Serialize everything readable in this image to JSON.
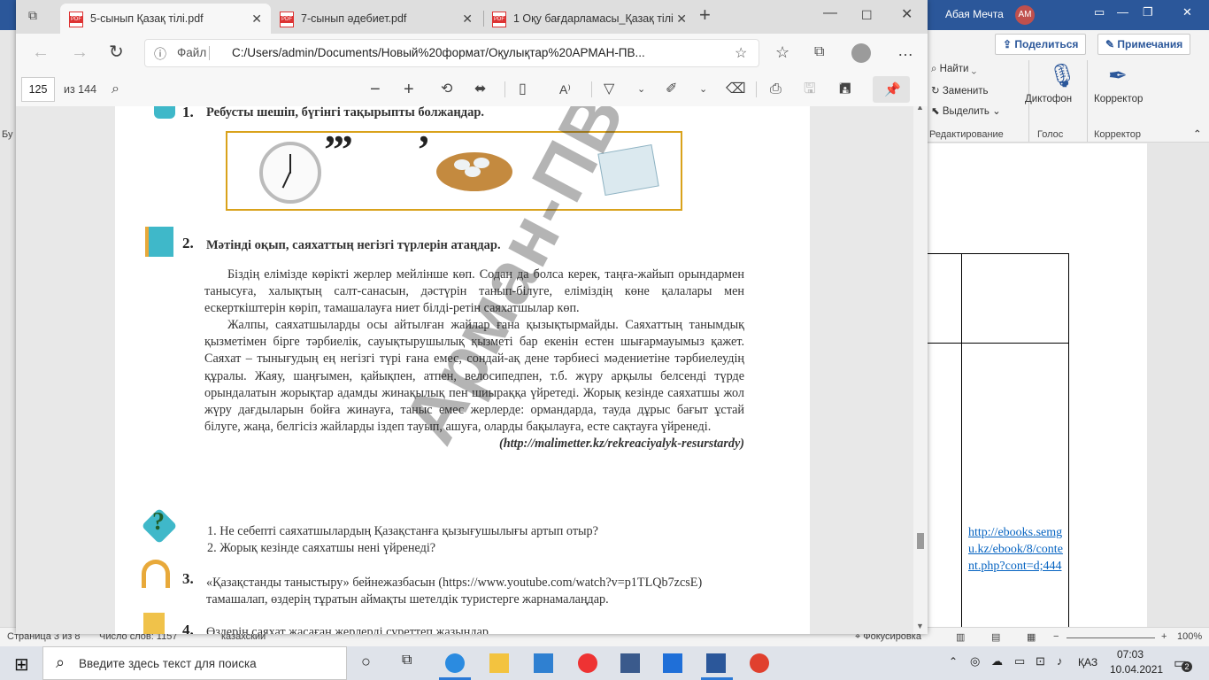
{
  "word": {
    "user_name": "Абая Мечта",
    "user_initials": "AM",
    "share_label": "Поделиться",
    "notes_label": "Примечания",
    "find_label": "Найти",
    "replace_label": "Заменить",
    "select_label": "Выделить",
    "dictate_label": "Диктофон",
    "corrector_label": "Корректор",
    "group_editing": "Редактирование",
    "group_voice": "Голос",
    "group_corrector": "Корректор",
    "left_cut_text": "Бу",
    "doc_link": "http://ebooks.semgu.kz/ebook/8/content.php?cont=d;444",
    "status": {
      "page": "Страница 3 из 8",
      "words": "Число слов: 1157",
      "language": "казахский",
      "focus": "Фокусировка",
      "zoom": "100%"
    }
  },
  "edge": {
    "tabs": [
      {
        "label": "5-сынып Қазақ тілі.pdf",
        "active": true
      },
      {
        "label": "7-сынып әдебиет.pdf",
        "active": false
      },
      {
        "label": "1 Оқу бағдарламасы_Қазақ тілі.",
        "active": false
      }
    ],
    "address": {
      "file_label": "Файл",
      "url": "C:/Users/admin/Documents/Новый%20формат/Оқулықтар%20АРМАН-ПВ..."
    },
    "pdf": {
      "page_number": "125",
      "page_total": "из 144"
    }
  },
  "page": {
    "task1": {
      "number": "1.",
      "text": "Ребусты шешіп, бүгінгі тақырыпты болжаңдар."
    },
    "rebus": {
      "quotes": "’’’",
      "comma": "’"
    },
    "task2": {
      "number": "2.",
      "text": "Мәтінді оқып, саяхаттың негізгі түрлерін атаңдар."
    },
    "paragraph1": "Біздің елімізде көрікті жерлер мейлінше көп. Содан да болса керек, таңға-жайып орындармен танысуға, халықтың салт-санасын, дәстүрін танып-білуге, еліміздің көне қалалары мен ескерткіштерін көріп, тамашалауға ниет білді-ретін саяхатшылар көп.",
    "paragraph2": "Жалпы, саяхатшыларды осы айтылған жайлар ғана қызықтырмайды. Саяхаттың танымдық қызметімен бірге тәрбиелік, сауықтырушылық қызметі бар екенін естен шығармауымыз қажет. Саяхат – тынығудың ең негізгі түрі ғана емес, сондай-ақ дене тәрбиесі мәдениетіне тәрбиелеудің құралы. Жаяу, шаңғымен, қайықпен, атпен, велосипедпен, т.б. жүру арқылы белсенді түрде орындалатын жорықтар адамды жинақылық пен шиыраққа үйретеді. Жорық кезінде саяхатшы жол жүру дағдыларын бойға жинауға, таныс емес жерлерде: ормандарда, тауда дұрыс бағыт ұстай білуге, жаңа, белгісіз жайларды іздеп тауып, ашуға, оларды бақылауға, есте сақтауға үйренеді.",
    "source": "(http://malimetter.kz/rekreaciyalyk-resurstardy)",
    "questions": [
      "1.   Не себепті саяхатшылардың Қазақстанға қызығушылығы артып отыр?",
      "2.   Жорық кезінде саяхатшы нені үйренеді?"
    ],
    "question_mark": "?",
    "task3": {
      "number": "3.",
      "text": "«Қазақстанды таныстыру» бейнежазбасын (https://www.youtube.com/watch?v=p1TLQb7zcsE) тамашалап, өздерің тұратын аймақты шетелдік туристерге жарнамалаңдар."
    },
    "task4": {
      "number": "4.",
      "text": "Өздерің саяхат жасаған жерлерді суреттеп жазыңдар."
    },
    "watermark": "Арман-ПВ баспасы"
  },
  "taskbar": {
    "search_placeholder": "Введите здесь текст для поиска",
    "language": "ҚАЗ",
    "time": "07:03",
    "date": "10.04.2021",
    "notifications": "2"
  },
  "colors": {
    "word_blue": "#2b579a",
    "accent_teal": "#3fb8c9",
    "rebus_border": "#d9a21b"
  }
}
